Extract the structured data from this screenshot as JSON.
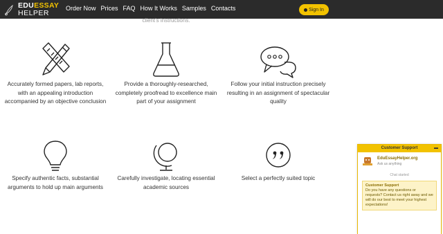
{
  "nav": {
    "logo": {
      "top_plain": "EDU",
      "top_accent": "ESSAY",
      "bottom": "HELPER"
    },
    "menu": [
      "Order Now",
      "Prices",
      "FAQ",
      "How It Works",
      "Samples",
      "Contacts"
    ],
    "signin_label": "Sign In"
  },
  "cut_text": "client's instructions.",
  "features": [
    {
      "icon": "ruler-pencil-icon",
      "text": "Accurately formed papers, lab reports, with an appealing introduction accompanied by an objective conclusion"
    },
    {
      "icon": "flask-icon",
      "text": "Provide a thoroughly-researched, completely proofread to excellence main part of your assignment"
    },
    {
      "icon": "chat-bubbles-icon",
      "text": "Follow your initial instruction precisely resulting in an assignment of spectacular quality"
    },
    {
      "icon": "lightbulb-icon",
      "text": "Specify authentic facts, substantial arguments to hold up main arguments"
    },
    {
      "icon": "globe-icon",
      "text": "Carefully investigate, locating essential academic sources"
    },
    {
      "icon": "quote-icon",
      "text": "Select a perfectly suited topic"
    }
  ],
  "chat": {
    "header": "Customer Support",
    "agent_name": "EduEssayHelper.org",
    "agent_sub": "Ask us anything",
    "started": "Chat started",
    "message_title": "Customer Support",
    "message_text": "Do you have any questions or requests? Contact us right away and we will do our best to meet your highest expectations!"
  },
  "colors": {
    "nav_bg": "#2b2b2b",
    "accent": "#f2c200"
  }
}
